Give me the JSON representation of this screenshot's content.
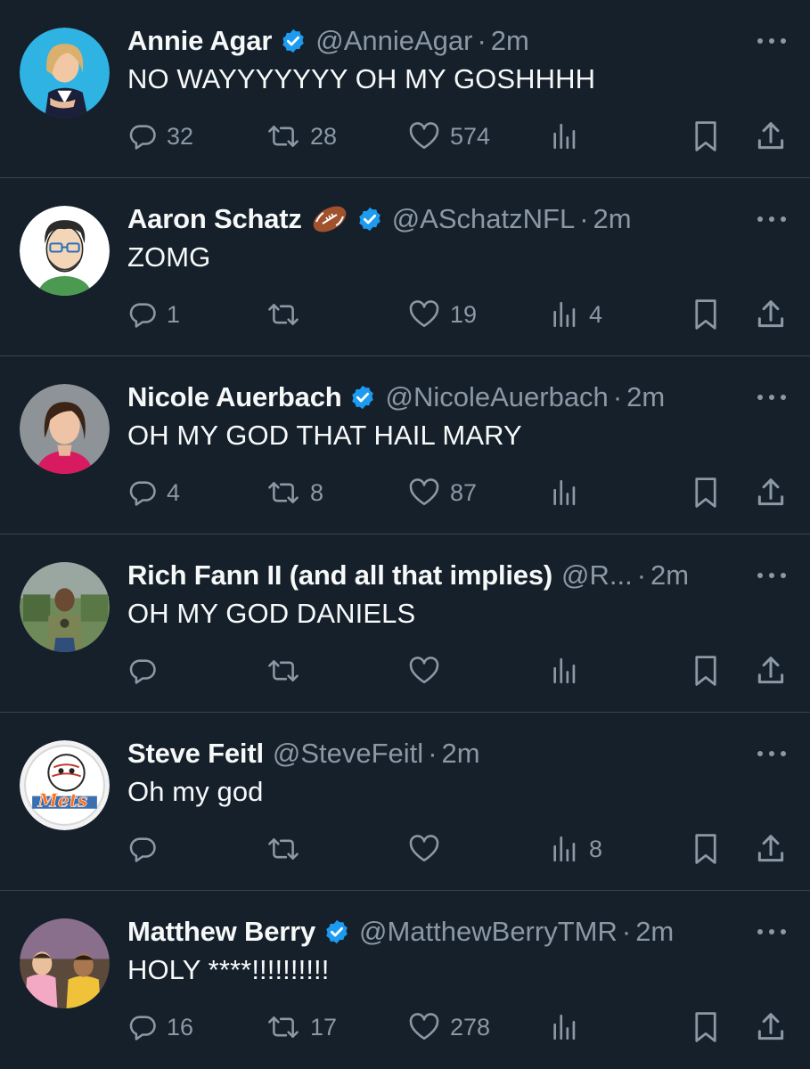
{
  "colors": {
    "background": "#15202b",
    "text": "#f7f9f9",
    "muted": "#8b98a5",
    "divider": "#38444d",
    "verified": "#1d9bf0"
  },
  "tweets": [
    {
      "name": "Annie Agar",
      "emoji": "",
      "verified": true,
      "handle": "@AnnieAgar",
      "time": "2m",
      "text": "NO WAYYYYYYY OH MY GOSHHHH",
      "replies": "32",
      "retweets": "28",
      "likes": "574",
      "views": "",
      "avatar": "annie-avatar"
    },
    {
      "name": "Aaron Schatz",
      "emoji": "football",
      "verified": true,
      "handle": "@ASchatzNFL",
      "time": "2m",
      "text": "ZOMG",
      "replies": "1",
      "retweets": "",
      "likes": "19",
      "views": "4",
      "avatar": "aaron-avatar"
    },
    {
      "name": "Nicole Auerbach",
      "emoji": "",
      "verified": true,
      "handle": "@NicoleAuerbach",
      "time": "2m",
      "text": "OH MY GOD THAT HAIL MARY",
      "replies": "4",
      "retweets": "8",
      "likes": "87",
      "views": "",
      "avatar": "nicole-avatar"
    },
    {
      "name": "Rich Fann II (and all that implies)",
      "emoji": "",
      "verified": false,
      "handle": "@R...",
      "time": "2m",
      "text": "OH MY GOD DANIELS",
      "replies": "",
      "retweets": "",
      "likes": "",
      "views": "",
      "avatar": "rich-avatar"
    },
    {
      "name": "Steve Feitl",
      "emoji": "",
      "verified": false,
      "handle": "@SteveFeitl",
      "time": "2m",
      "text": "Oh my god",
      "replies": "",
      "retweets": "",
      "likes": "",
      "views": "8",
      "avatar": "steve-avatar"
    },
    {
      "name": "Matthew Berry",
      "emoji": "",
      "verified": true,
      "handle": "@MatthewBerryTMR",
      "time": "2m",
      "text": "HOLY ****!!!!!!!!!!",
      "replies": "16",
      "retweets": "17",
      "likes": "278",
      "views": "",
      "avatar": "matthew-avatar"
    }
  ],
  "separator": "·",
  "avatar_logo_text": "Mets"
}
